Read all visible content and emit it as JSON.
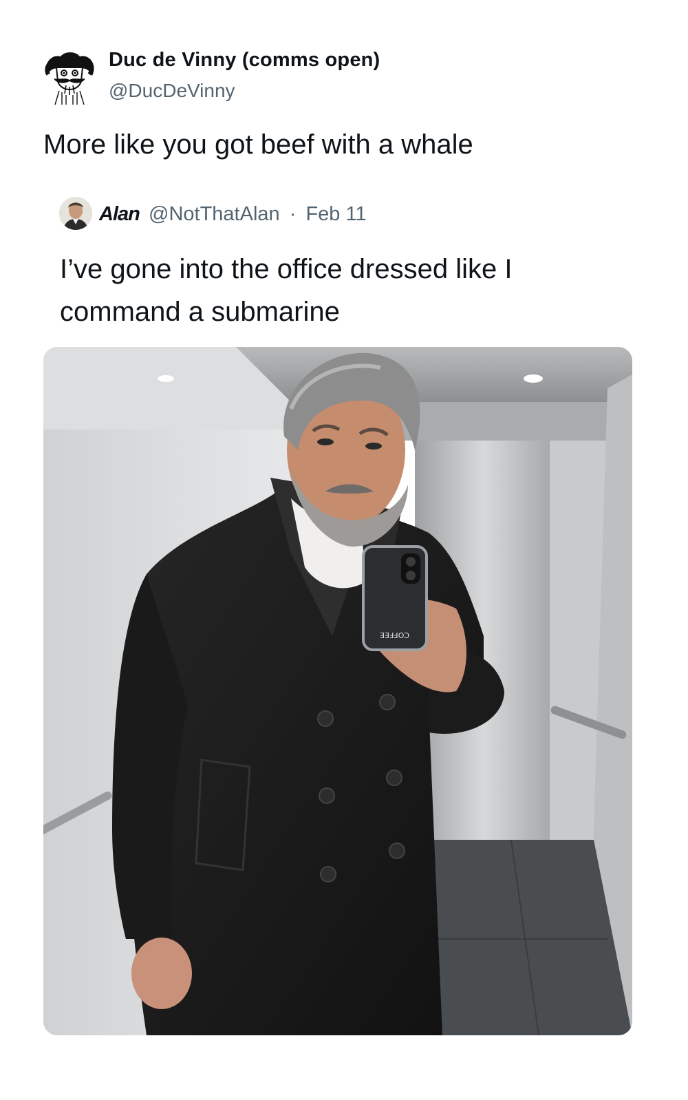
{
  "tweet": {
    "author": {
      "display_name": "Duc de Vinny (comms open)",
      "handle": "@DucDeVinny",
      "avatar_icon": "cartoon-mustache-avatar-icon"
    },
    "text": "More like you got beef with a whale"
  },
  "quoted_tweet": {
    "author": {
      "display_name": "Alan",
      "handle": "@NotThatAlan",
      "avatar_icon": "profile-photo-avatar"
    },
    "separator": "·",
    "date": "Feb 11",
    "text": "I’ve gone into the office dressed like I command a submarine",
    "media": {
      "type": "photo",
      "description_icon": "elevator-mirror-selfie-photo",
      "phone_sticker_text": "COFFEE"
    }
  },
  "colors": {
    "text_primary": "#0f1419",
    "text_secondary": "#536471",
    "background": "#ffffff"
  }
}
